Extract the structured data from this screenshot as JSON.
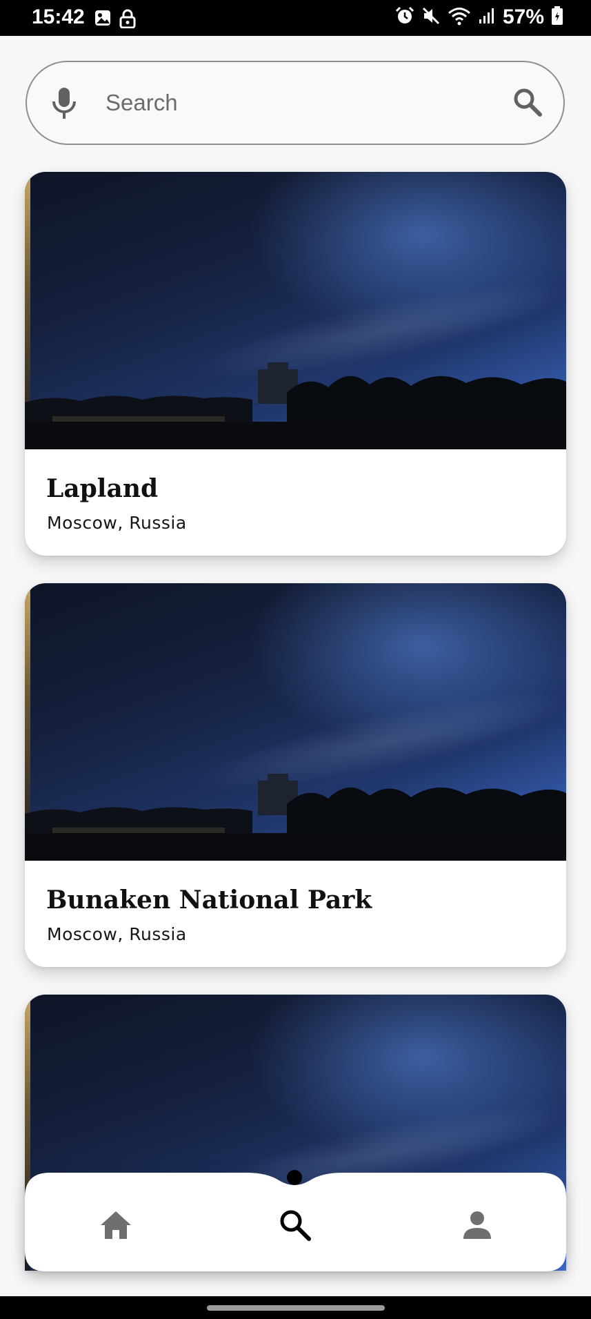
{
  "status_bar": {
    "time": "15:42",
    "battery": "57%",
    "left_icons": [
      "image-icon",
      "lock-icon"
    ],
    "right_icons": [
      "alarm-icon",
      "mute-icon",
      "wifi-icon",
      "signal-icon",
      "battery-icon"
    ]
  },
  "search": {
    "placeholder": "Search",
    "value": ""
  },
  "cards": [
    {
      "title": "Lapland",
      "subtitle": "Moscow, Russia"
    },
    {
      "title": "Bunaken National Park",
      "subtitle": "Moscow, Russia"
    }
  ],
  "bottom_nav": {
    "items": [
      {
        "icon": "home-icon",
        "active": false
      },
      {
        "icon": "search-icon",
        "active": true
      },
      {
        "icon": "person-icon",
        "active": false
      }
    ]
  },
  "colors": {
    "active_icon": "#000000",
    "inactive_icon": "#6f6f6f",
    "sky_top": "#3f6fcf",
    "sky_bottom": "#0f1426"
  }
}
